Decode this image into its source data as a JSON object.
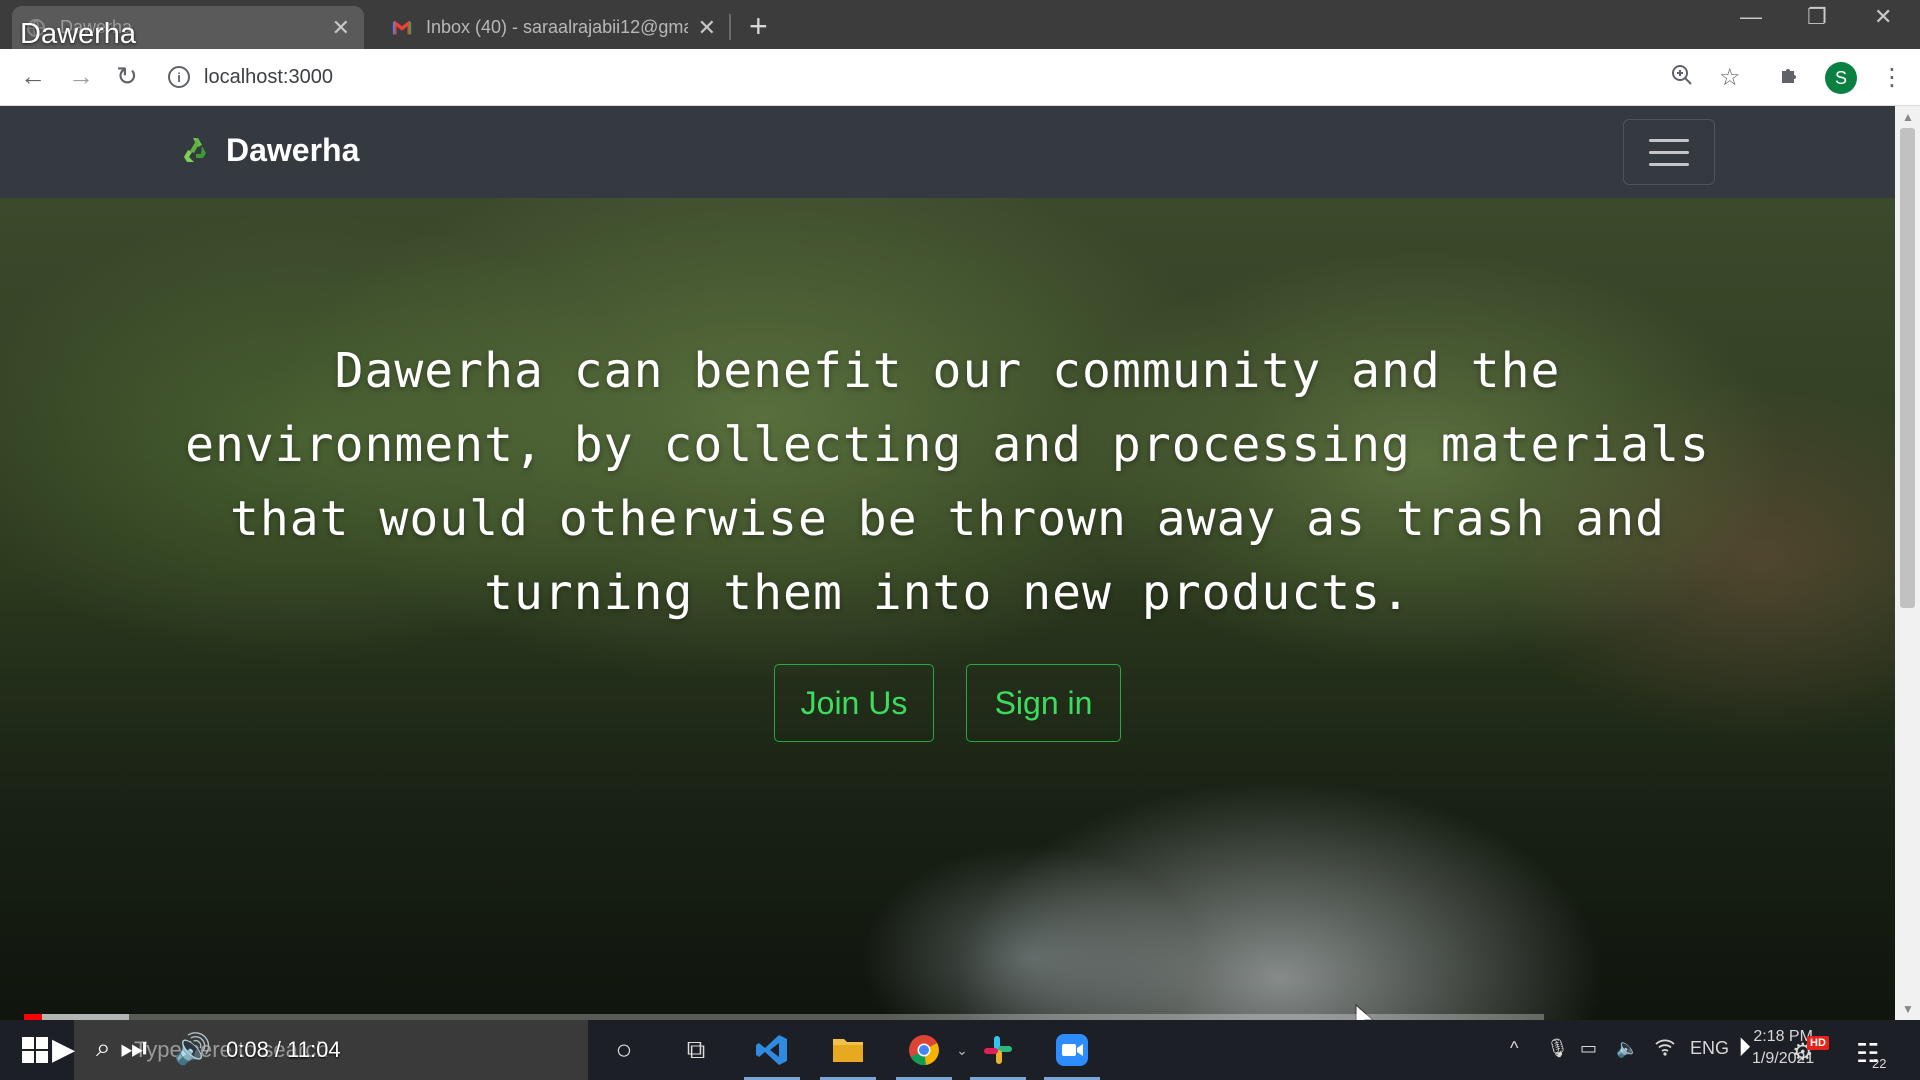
{
  "overlay": {
    "video_title": "Dawerha"
  },
  "browser": {
    "tabs": [
      {
        "title": "Dawerha",
        "active": true,
        "favicon": "globe-icon"
      },
      {
        "title": "Inbox (40) - saraalrajabii12@gma",
        "active": false,
        "favicon": "gmail-icon"
      }
    ],
    "url": "localhost:3000",
    "profile_initial": "S"
  },
  "site": {
    "brand": "Dawerha",
    "logo_icon": "recycle-icon",
    "hero_text": "Dawerha can benefit our community and the environment, by collecting and processing materials that would otherwise be thrown away as trash and turning them into new products.",
    "buttons": {
      "join": "Join Us",
      "signin": "Sign in"
    },
    "accent_color": "#28a745",
    "navbar_color": "#343a40"
  },
  "player": {
    "current_time": "0:08",
    "duration": "11:04",
    "time_display": "0:08 / 11:04",
    "hd_badge": "HD",
    "played_fraction": 0.012,
    "buffered_fraction": 0.069
  },
  "taskbar": {
    "search_placeholder": "Type here to search",
    "language": "ENG",
    "time": "2:18 PM",
    "date": "1/9/2021",
    "notification_count": "22"
  }
}
